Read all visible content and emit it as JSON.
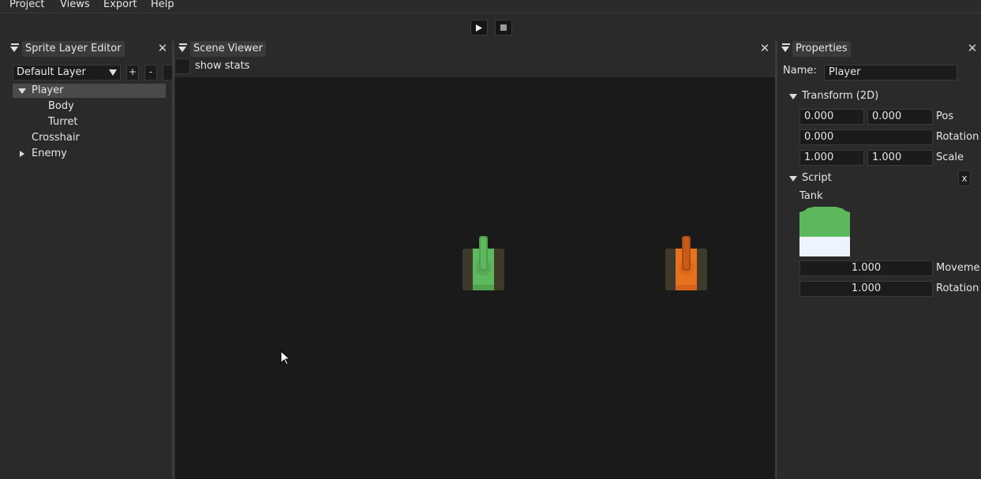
{
  "menu": {
    "items": [
      "Project",
      "Views",
      "Export",
      "Help"
    ]
  },
  "toolbar": {
    "play_icon": "play-icon",
    "stop_icon": "stop-icon"
  },
  "layer_editor": {
    "title": "Sprite Layer Editor",
    "layer_select": "Default Layer",
    "add_label": "+",
    "remove_label": "-",
    "tree": [
      {
        "label": "Player",
        "expanded": true,
        "selected": true
      },
      {
        "label": "Body"
      },
      {
        "label": "Turret"
      },
      {
        "label": "Crosshair"
      },
      {
        "label": "Enemy",
        "expanded": false
      }
    ]
  },
  "scene_viewer": {
    "title": "Scene Viewer",
    "show_stats_label": "show stats",
    "show_stats_checked": false,
    "player_color": "#5cb85c",
    "enemy_color": "#e8711f"
  },
  "properties": {
    "title": "Properties",
    "name_label": "Name:",
    "name_value": "Player",
    "transform": {
      "header": "Transform (2D)",
      "pos_x": "0.000",
      "pos_y": "0.000",
      "pos_label": "Pos",
      "rotation": "0.000",
      "rotation_label": "Rotation",
      "scale_x": "1.000",
      "scale_y": "1.000",
      "scale_label": "Scale"
    },
    "script": {
      "header": "Script",
      "remove_label": "x",
      "name": "Tank",
      "movement_value": "1.000",
      "movement_label": "Moveme",
      "rotation_value": "1.000",
      "rotation_label": "Rotation"
    }
  }
}
